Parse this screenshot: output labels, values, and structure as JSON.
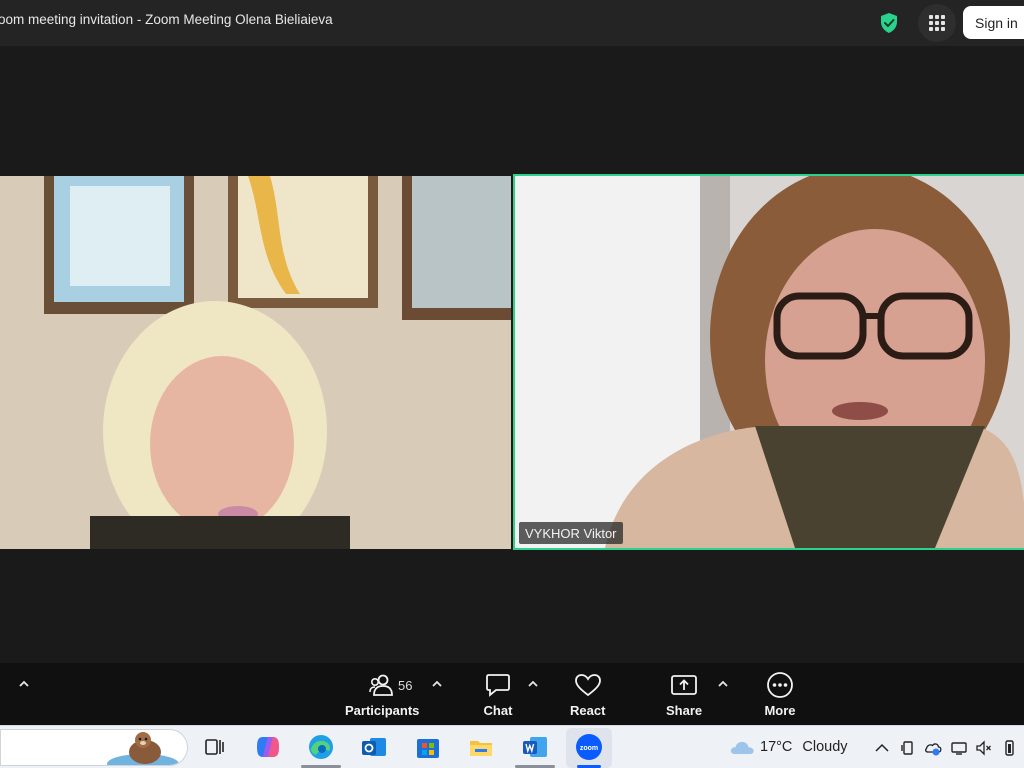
{
  "window": {
    "title": "oom meeting invitation - Zoom Meeting Olena Bieliaieva",
    "sign_in_label": "Sign in",
    "security_color": "#2ad38c"
  },
  "participants": [
    {
      "name": "",
      "active_speaker": false
    },
    {
      "name": "VYKHOR Viktor",
      "active_speaker": true
    }
  ],
  "toolbar": {
    "participants_label": "Participants",
    "participants_count": "56",
    "chat_label": "Chat",
    "react_label": "React",
    "share_label": "Share",
    "more_label": "More"
  },
  "taskbar": {
    "pinned": [
      "task-view-icon",
      "copilot-icon",
      "edge-icon",
      "outlook-icon",
      "microsoft-store-icon",
      "file-explorer-icon",
      "word-icon",
      "zoom-icon"
    ],
    "weather_temp": "17°C",
    "weather_condition": "Cloudy"
  }
}
